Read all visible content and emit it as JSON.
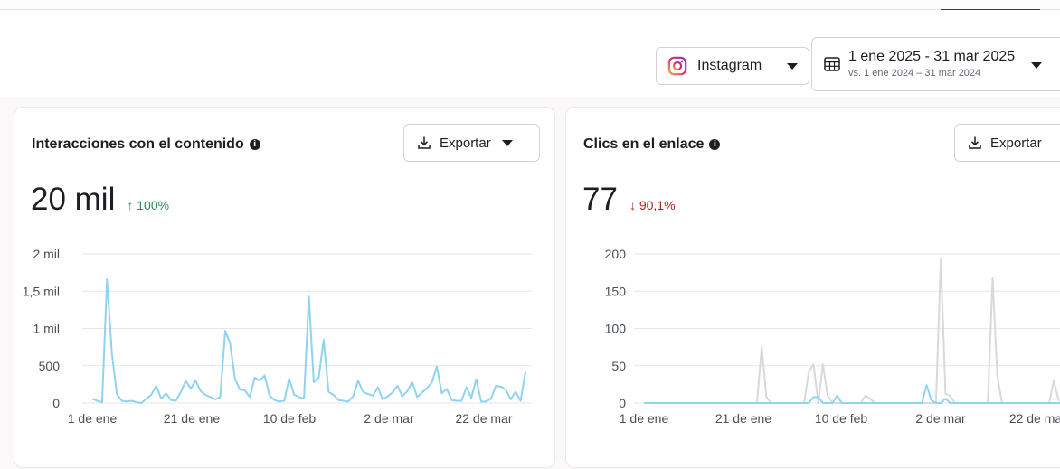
{
  "filters": {
    "platform": {
      "label": "Instagram",
      "icon": "instagram-icon"
    },
    "date": {
      "range": "1 ene 2025 - 31 mar 2025",
      "comparison": "vs. 1 ene 2024 – 31 mar 2024",
      "icon": "calendar-icon"
    }
  },
  "colors": {
    "accent_line": "#8fd3f0",
    "compare_line": "#d9d9d9",
    "positive": "#2e8b57",
    "negative": "#b3261e",
    "grid": "#e4e6eb"
  },
  "cards": [
    {
      "title": "Interacciones con el contenido",
      "export_label": "Exportar",
      "value": "20 mil",
      "delta": "↑ 100%",
      "delta_direction": "up"
    },
    {
      "title": "Clics en el enlace",
      "export_label": "Exportar",
      "value": "77",
      "delta": "↓ 90,1%",
      "delta_direction": "down"
    }
  ],
  "chart_data": [
    {
      "type": "line",
      "x_labels": [
        "1 de ene",
        "21 de ene",
        "10 de feb",
        "2 de mar",
        "22 de mar"
      ],
      "y_ticks": [
        0,
        500,
        1000,
        1500,
        2000
      ],
      "y_tick_labels": [
        "0",
        "500",
        "1 mil",
        "1,5 mil",
        "2 mil"
      ],
      "ylim": [
        0,
        2000
      ],
      "grid": true,
      "series": [
        {
          "color": "#8fd3f0",
          "values": [
            60,
            30,
            10,
            1660,
            650,
            120,
            30,
            20,
            30,
            10,
            0,
            60,
            110,
            230,
            60,
            130,
            40,
            30,
            150,
            300,
            190,
            300,
            160,
            110,
            80,
            50,
            80,
            970,
            800,
            320,
            180,
            170,
            80,
            340,
            300,
            370,
            100,
            40,
            20,
            30,
            330,
            110,
            80,
            60,
            1430,
            280,
            340,
            850,
            150,
            110,
            40,
            30,
            20,
            90,
            300,
            150,
            120,
            100,
            210,
            50,
            90,
            140,
            230,
            90,
            160,
            280,
            80,
            140,
            200,
            280,
            490,
            130,
            190,
            40,
            30,
            30,
            210,
            70,
            320,
            20,
            20,
            60,
            230,
            220,
            180,
            50,
            150,
            30,
            420
          ]
        }
      ]
    },
    {
      "type": "line",
      "x_labels": [
        "1 de ene",
        "21 de ene",
        "10 de feb",
        "2 de mar",
        "22 de ma"
      ],
      "y_ticks": [
        0,
        50,
        100,
        150,
        200
      ],
      "y_tick_labels": [
        "0",
        "50",
        "100",
        "150",
        "200"
      ],
      "ylim": [
        0,
        200
      ],
      "grid": true,
      "series": [
        {
          "color": "#d9d9d9",
          "values": [
            0,
            0,
            0,
            0,
            0,
            0,
            0,
            0,
            0,
            0,
            0,
            0,
            0,
            0,
            0,
            0,
            0,
            0,
            0,
            0,
            0,
            0,
            0,
            0,
            0,
            76,
            8,
            0,
            0,
            0,
            0,
            0,
            0,
            0,
            0,
            42,
            52,
            0,
            52,
            10,
            0,
            0,
            0,
            0,
            0,
            0,
            0,
            10,
            6,
            0,
            0,
            0,
            0,
            0,
            0,
            0,
            0,
            0,
            0,
            0,
            0,
            0,
            0,
            193,
            12,
            10,
            0,
            0,
            0,
            0,
            0,
            0,
            0,
            0,
            168,
            36,
            0,
            0,
            0,
            0,
            0,
            0,
            0,
            0,
            0,
            0,
            0,
            30,
            4,
            0,
            0,
            0
          ]
        },
        {
          "color": "#8fd3f0",
          "values": [
            0,
            0,
            0,
            0,
            0,
            0,
            0,
            0,
            0,
            0,
            0,
            0,
            0,
            0,
            0,
            0,
            0,
            0,
            0,
            0,
            0,
            0,
            0,
            0,
            0,
            0,
            0,
            0,
            0,
            0,
            0,
            0,
            0,
            0,
            0,
            0,
            8,
            8,
            0,
            0,
            0,
            10,
            0,
            0,
            0,
            0,
            0,
            0,
            0,
            0,
            0,
            0,
            0,
            0,
            0,
            0,
            0,
            0,
            0,
            0,
            24,
            4,
            0,
            0,
            6,
            0,
            0,
            0,
            0,
            0,
            0,
            0,
            0,
            0,
            0,
            0,
            0,
            0,
            0,
            0,
            0,
            0,
            0,
            0,
            0,
            0,
            0,
            0,
            0,
            0,
            0,
            6
          ]
        }
      ]
    }
  ]
}
